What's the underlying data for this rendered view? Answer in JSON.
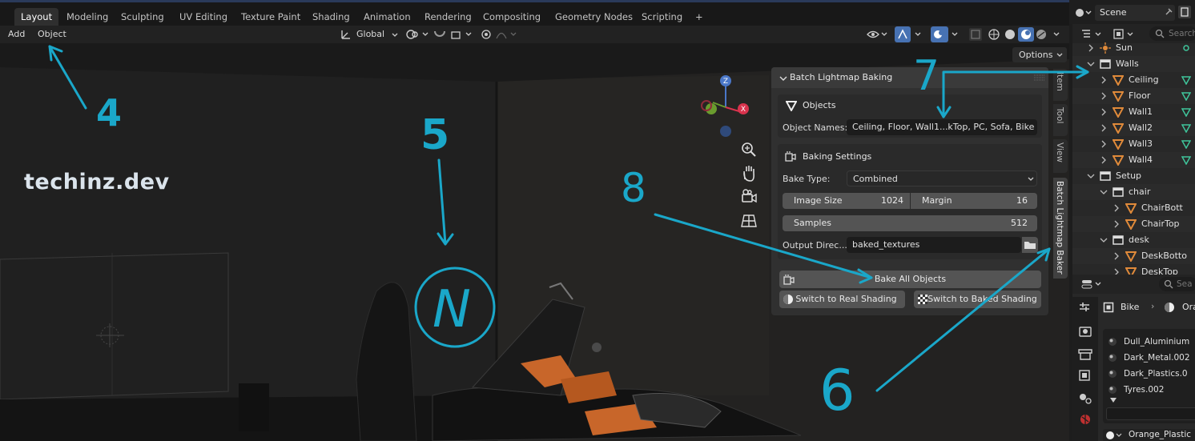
{
  "workspace_tabs": [
    "Layout",
    "Modeling",
    "Sculpting",
    "UV Editing",
    "Texture Paint",
    "Shading",
    "Animation",
    "Rendering",
    "Compositing",
    "Geometry Nodes",
    "Scripting",
    "+"
  ],
  "header_menu": {
    "add": "Add",
    "object": "Object",
    "transform": "Global",
    "options": "Options"
  },
  "scene": {
    "name": "Scene"
  },
  "watermark": "techinz.dev",
  "panel": {
    "title": "Batch Lightmap Baking",
    "objects_header": "Objects",
    "object_names_label": "Object Names:",
    "object_names_value": "Ceiling, Floor, Wall1...kTop, PC, Sofa, Bike",
    "baking_settings_header": "Baking Settings",
    "bake_type_label": "Bake Type:",
    "bake_type_value": "Combined",
    "image_size_label": "Image Size",
    "image_size_value": "1024",
    "margin_label": "Margin",
    "margin_value": "16",
    "samples_label": "Samples",
    "samples_value": "512",
    "output_dir_label": "Output Direc...",
    "output_dir_value": "baked_textures",
    "bake_all": "Bake All Objects",
    "switch_real": "Switch to Real Shading",
    "switch_baked": "Switch to Baked Shading"
  },
  "side_tabs": [
    "Item",
    "Tool",
    "View",
    "Batch Lightmap Baker"
  ],
  "outliner": [
    {
      "label": "Sun",
      "indent": 1,
      "kind": "light"
    },
    {
      "label": "Walls",
      "indent": 1,
      "kind": "collection",
      "expanded": true
    },
    {
      "label": "Ceiling",
      "indent": 2,
      "kind": "mesh"
    },
    {
      "label": "Floor",
      "indent": 2,
      "kind": "mesh"
    },
    {
      "label": "Wall1",
      "indent": 2,
      "kind": "mesh"
    },
    {
      "label": "Wall2",
      "indent": 2,
      "kind": "mesh"
    },
    {
      "label": "Wall3",
      "indent": 2,
      "kind": "mesh"
    },
    {
      "label": "Wall4",
      "indent": 2,
      "kind": "mesh"
    },
    {
      "label": "Setup",
      "indent": 1,
      "kind": "collection",
      "expanded": true
    },
    {
      "label": "chair",
      "indent": 2,
      "kind": "collection",
      "expanded": true
    },
    {
      "label": "ChairBott",
      "indent": 3,
      "kind": "mesh"
    },
    {
      "label": "ChairTop",
      "indent": 3,
      "kind": "mesh"
    },
    {
      "label": "desk",
      "indent": 2,
      "kind": "collection",
      "expanded": true
    },
    {
      "label": "DeskBotto",
      "indent": 3,
      "kind": "mesh"
    },
    {
      "label": "DeskTop",
      "indent": 3,
      "kind": "mesh"
    }
  ],
  "outliner_search": "Search",
  "properties": {
    "search": "Sea",
    "object": "Bike",
    "material_short": "Ora",
    "materials": [
      "Dull_Aluminium",
      "Dark_Metal.002",
      "Dark_Plastics.0",
      "Tyres.002"
    ],
    "active_material": "Orange_Plastic"
  },
  "annotations": [
    "4",
    "5",
    "N",
    "6",
    "7",
    "8"
  ],
  "colors": {
    "accent": "#1aa7c9",
    "orange": "#e08a3a",
    "mesh_green": "#3fc59b"
  }
}
